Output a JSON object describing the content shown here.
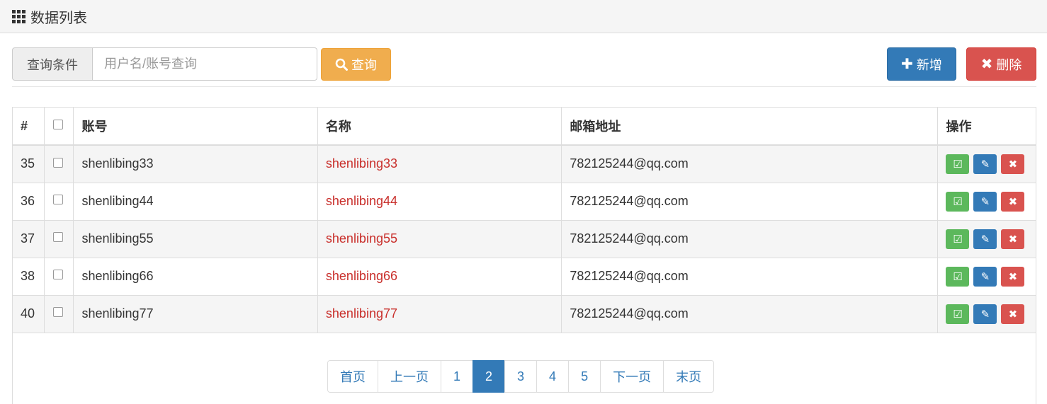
{
  "header": {
    "title": "数据列表",
    "icon": "grid-icon"
  },
  "search": {
    "addon": "查询条件",
    "placeholder": "用户名/账号查询",
    "button": "查询"
  },
  "actions": {
    "add": "新增",
    "delete": "删除"
  },
  "colors": {
    "primary": "#337ab7",
    "warning": "#f0ad4e",
    "danger": "#d9534f",
    "success": "#5cb85c",
    "name_text": "#c9302c"
  },
  "table": {
    "headers": [
      "#",
      "",
      "账号",
      "名称",
      "邮箱地址",
      "操作"
    ],
    "rows": [
      {
        "id": "35",
        "account": "shenlibing33",
        "name": "shenlibing33",
        "email": "782125244@qq.com"
      },
      {
        "id": "36",
        "account": "shenlibing44",
        "name": "shenlibing44",
        "email": "782125244@qq.com"
      },
      {
        "id": "37",
        "account": "shenlibing55",
        "name": "shenlibing55",
        "email": "782125244@qq.com"
      },
      {
        "id": "38",
        "account": "shenlibing66",
        "name": "shenlibing66",
        "email": "782125244@qq.com"
      },
      {
        "id": "40",
        "account": "shenlibing77",
        "name": "shenlibing77",
        "email": "782125244@qq.com"
      }
    ]
  },
  "pagination": {
    "items": [
      "首页",
      "上一页",
      "1",
      "2",
      "3",
      "4",
      "5",
      "下一页",
      "末页"
    ],
    "active": "2"
  }
}
